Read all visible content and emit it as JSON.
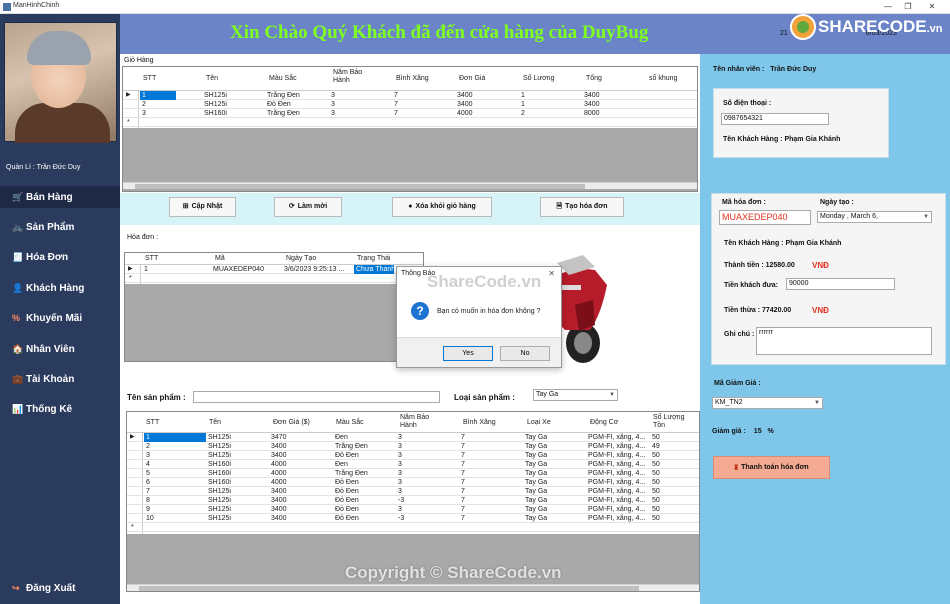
{
  "window": {
    "title": "ManHinhChinh",
    "minimize": "—",
    "maximize": "❐",
    "close": "✕"
  },
  "sidebar": {
    "manager_label": "Quản Lí : Trần Đức  Duy",
    "items": [
      {
        "label": "Bán Hàng",
        "icon": "🛒"
      },
      {
        "label": "Sản Phẩm",
        "icon": "🚲"
      },
      {
        "label": "Hóa Đơn",
        "icon": "🧾"
      },
      {
        "label": "Khách Hàng",
        "icon": "👤"
      },
      {
        "label": "Khuyến Mãi",
        "icon": "%"
      },
      {
        "label": "Nhân Viên",
        "icon": "🏠"
      },
      {
        "label": "Tài Khoản",
        "icon": "💼"
      },
      {
        "label": "Thống Kê",
        "icon": "📊"
      }
    ],
    "logout": {
      "label": "Đăng Xuất",
      "icon": "↪"
    }
  },
  "header": {
    "welcome": "Xin Chào Quý Khách đã đến cửa hàng của DuyBug",
    "date_visible_start": "21",
    "date_visible_end": "6/03/2023"
  },
  "logo": {
    "text": "SHARECODE",
    "suffix": ".vn"
  },
  "cart": {
    "title": "Giỏ Hàng",
    "columns": [
      "STT",
      "Tên",
      "Màu Sắc",
      "Năm Bảo Hành",
      "Bình Xăng",
      "Đơn Giá",
      "Số Lương",
      "Tổng",
      "số khung"
    ],
    "rows": [
      [
        "1",
        "SH125i",
        "Trắng Đen",
        "3",
        "7",
        "3400",
        "1",
        "3400",
        ""
      ],
      [
        "2",
        "SH125i",
        "Đỏ Đen",
        "3",
        "7",
        "3400",
        "1",
        "3400",
        ""
      ],
      [
        "3",
        "SH160i",
        "Trắng Đen",
        "3",
        "7",
        "4000",
        "2",
        "8000",
        ""
      ]
    ]
  },
  "toolbar": {
    "update": "Cập Nhật",
    "refresh": "Làm mới",
    "remove": "Xóa khỏi giỏ hàng",
    "create_invoice": "Tạo hóa đơn"
  },
  "invoices": {
    "title": "Hóa đơn :",
    "columns": [
      "STT",
      "Mã",
      "Ngày Tạo",
      "Trạng Thái"
    ],
    "rows": [
      [
        "1",
        "MUAXEDEP040",
        "3/6/2023 9:25:13 ...",
        "Chưa Thanh"
      ]
    ]
  },
  "dialog": {
    "title": "Thông Báo",
    "message": "Bạn có muốn in hóa đơn không ?",
    "yes": "Yes",
    "no": "No",
    "close": "✕"
  },
  "product_filter": {
    "name_label": "Tên sản phẩm :",
    "name_value": "",
    "type_label": "Loại sản phẩm :",
    "type_value": "Tay Ga"
  },
  "products": {
    "columns": [
      "STT",
      "Tên",
      "Đơn Giá ($)",
      "Màu Sắc",
      "Năm Bảo Hành",
      "Bình Xăng",
      "Loại Xe",
      "Động Cơ",
      "Số Lượng Tồn"
    ],
    "rows": [
      [
        "1",
        "SH125i",
        "3470",
        "Đen",
        "3",
        "7",
        "Tay Ga",
        "PGM-FI, xăng, 4...",
        "50"
      ],
      [
        "2",
        "SH125i",
        "3400",
        "Trắng Đen",
        "3",
        "7",
        "Tay Ga",
        "PGM-FI, xăng, 4...",
        "49"
      ],
      [
        "3",
        "SH125i",
        "3400",
        "Đỏ Đen",
        "3",
        "7",
        "Tay Ga",
        "PGM-FI, xăng, 4...",
        "50"
      ],
      [
        "4",
        "SH160i",
        "4000",
        "Đen",
        "3",
        "7",
        "Tay Ga",
        "PGM-FI, xăng, 4...",
        "50"
      ],
      [
        "5",
        "SH160i",
        "4000",
        "Trắng Đen",
        "3",
        "7",
        "Tay Ga",
        "PGM-FI, xăng, 4...",
        "50"
      ],
      [
        "6",
        "SH160i",
        "4000",
        "Đỏ Đen",
        "3",
        "7",
        "Tay Ga",
        "PGM-FI, xăng, 4...",
        "50"
      ],
      [
        "7",
        "SH125i",
        "3400",
        "Đỏ Đen",
        "3",
        "7",
        "Tay Ga",
        "PGM-FI, xăng, 4...",
        "50"
      ],
      [
        "8",
        "SH125i",
        "3400",
        "Đỏ Đen",
        "-3",
        "7",
        "Tay Ga",
        "PGM-FI, xăng, 4...",
        "50"
      ],
      [
        "9",
        "SH125i",
        "3400",
        "Đỏ Đen",
        "3",
        "7",
        "Tay Ga",
        "PGM-FI, xăng, 4...",
        "50"
      ],
      [
        "10",
        "SH125i",
        "3400",
        "Đỏ Đen",
        "-3",
        "7",
        "Tay Ga",
        "PGM-FI, xăng, 4...",
        "50"
      ]
    ]
  },
  "staff": {
    "label": "Tên nhân viên :",
    "value": "Trần Đức  Duy"
  },
  "customer": {
    "phone_label": "Số điện thoại :",
    "phone_value": "0987654321",
    "name_label": "Tên Khách Hàng : Phạm Gia  Khánh"
  },
  "invoice_form": {
    "code_label": "Mã hóa đơn :",
    "code_value": "MUAXEDEP040",
    "date_label": "Ngày tạo :",
    "date_value": "Monday  ,   March      6,",
    "customer_label": "Tên Khách Hàng :  Phạm Gia  Khánh",
    "total_label": "Thành tiền : 12580.00",
    "total_currency": "VNĐ",
    "paid_label": "Tiền khách đưa:",
    "paid_value": "90000",
    "change_label": "Tiền thừa :   77420.00",
    "change_currency": "VNĐ",
    "note_label": "Ghi chú :",
    "note_value": "rrrrrr"
  },
  "voucher": {
    "label": "Mã Giảm Giá :",
    "value": "KM_TN2",
    "discount_label": "Giảm giá :",
    "discount_value": "15",
    "discount_unit": "%"
  },
  "pay_button": "Thanh toán hóa đơn",
  "watermarks": {
    "bottom": "Copyright © ShareCode.vn",
    "middle": "ShareCode.vn"
  },
  "colors": {
    "sidebar": "#2b3b5e",
    "header": "#6b84c8",
    "welcome_text": "#7fff1f",
    "right_panel": "#7fc7ea",
    "accent_red": "#e0301e",
    "selection": "#0078d7"
  }
}
